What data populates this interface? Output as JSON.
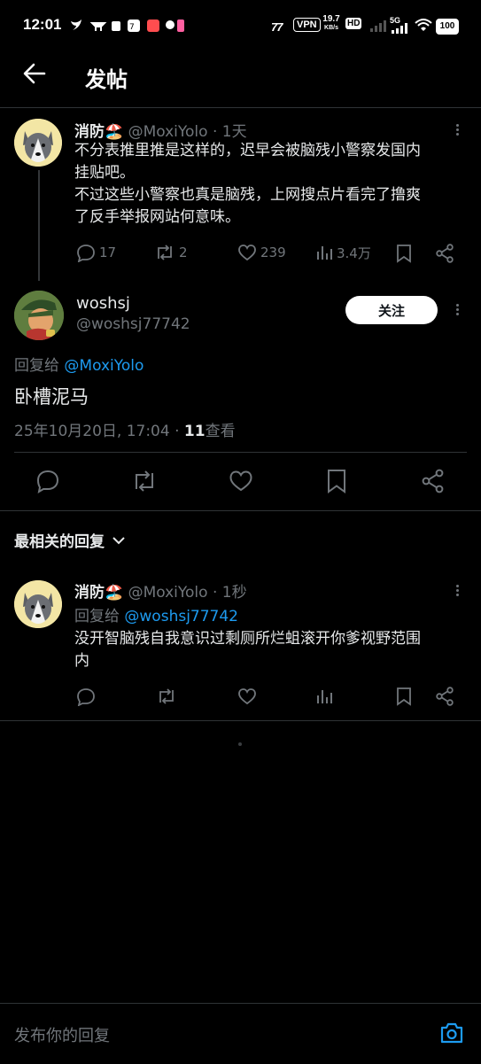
{
  "status": {
    "time": "12:01",
    "speed": "19.7",
    "speed_unit": "KB/s",
    "vpn": "VPN",
    "network": "5G",
    "battery": "100",
    "net_badge": "77"
  },
  "header": {
    "title": "发帖"
  },
  "parent_post": {
    "display_name": "消防🏖️",
    "handle": "@MoxiYolo",
    "time": "· 1天",
    "text_lines": [
      "不分表推里推是这样的，迟早会被脑残小警察发国内",
      "挂贴吧。",
      "不过这些小警察也真是脑残，上网搜点片看完了撸爽",
      "了反手举报网站何意味。"
    ],
    "replies": "17",
    "reposts": "2",
    "likes": "239",
    "views": "3.4万"
  },
  "main_post": {
    "display_name": "woshsj",
    "handle": "@woshsj77742",
    "follow_label": "关注",
    "reply_to_prefix": "回复给",
    "reply_to_handle": "@MoxiYolo",
    "text": "卧槽泥马",
    "timestamp": "25年10月20日, 17:04 ·",
    "views_count": "11",
    "views_label": "查看"
  },
  "sort": {
    "label": "最相关的回复"
  },
  "reply_post": {
    "display_name": "消防🏖️",
    "handle": "@MoxiYolo",
    "time": "· 1秒",
    "reply_to_prefix": "回复给",
    "reply_to_handle": "@woshsj77742",
    "text_lines": [
      "没开智脑残自我意识过剩厕所烂蛆滚开你爹视野范围",
      "内"
    ]
  },
  "composer": {
    "placeholder": "发布你的回复"
  },
  "colors": {
    "accent": "#1d9bf0",
    "muted": "#71767b",
    "divider": "#2f3336"
  }
}
